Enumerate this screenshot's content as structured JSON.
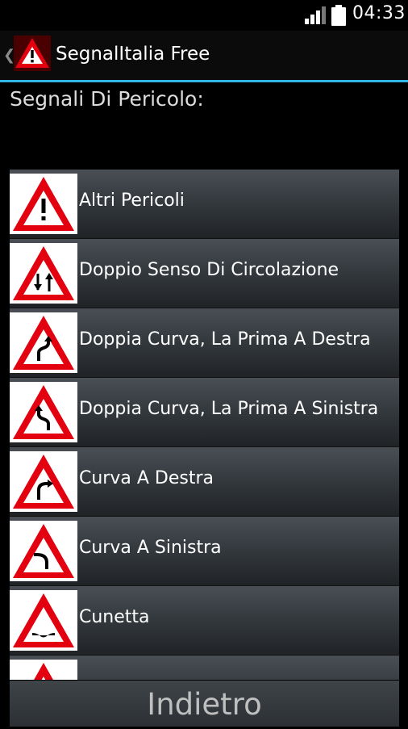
{
  "status_bar": {
    "time": "04:33"
  },
  "action_bar": {
    "title": "SegnalItalia Free"
  },
  "section": {
    "title": "Segnali Di Pericolo:"
  },
  "signs": [
    {
      "label": "Altri Pericoli",
      "icon": "exclamation-sign-icon"
    },
    {
      "label": "Doppio Senso Di Circolazione",
      "icon": "two-way-traffic-sign-icon"
    },
    {
      "label": "Doppia Curva, La Prima A Destra",
      "icon": "double-curve-right-sign-icon"
    },
    {
      "label": "Doppia Curva, La Prima A Sinistra",
      "icon": "double-curve-left-sign-icon"
    },
    {
      "label": "Curva A Destra",
      "icon": "curve-right-sign-icon"
    },
    {
      "label": "Curva A Sinistra",
      "icon": "curve-left-sign-icon"
    },
    {
      "label": "Cunetta",
      "icon": "dip-sign-icon"
    },
    {
      "label": "",
      "icon": "warning-sign-icon"
    }
  ],
  "footer": {
    "back_label": "Indietro"
  },
  "colors": {
    "accent": "#33b5e5",
    "sign_red": "#e3000f"
  }
}
